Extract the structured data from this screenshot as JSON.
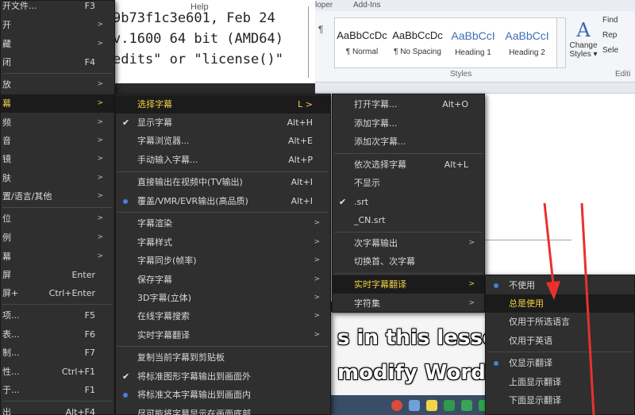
{
  "console": {
    "lines": [
      "9b73f1c3e601, Feb 24",
      "v.1600 64 bit (AMD64)",
      "",
      "edits\" or \"license()\""
    ],
    "tab_label": "Help"
  },
  "word": {
    "tabs": [
      "loper",
      "Add-Ins"
    ],
    "paragraph_mark": "¶",
    "styles": [
      {
        "preview": "AaBbCcDc",
        "name": "¶ Normal"
      },
      {
        "preview": "AaBbCcDc",
        "name": "¶ No Spacing"
      },
      {
        "preview": "AaBbCcI",
        "name": "Heading 1"
      },
      {
        "preview": "AaBbCcI",
        "name": "Heading 2"
      }
    ],
    "change_styles": {
      "glyph": "A",
      "label_line1": "Change",
      "label_line2": "Styles ▾"
    },
    "editing": [
      "Find",
      "Rep",
      "Sele"
    ],
    "captions": {
      "styles": "Styles",
      "editing": "Editi"
    }
  },
  "video": {
    "subtitle_line1": "s in this lesson",
    "subtitle_line2": "modify Word"
  },
  "menu_main": {
    "items": [
      {
        "label": "开文件...",
        "shortcut": "F3",
        "arrow": false
      },
      {
        "label": "开",
        "shortcut": "",
        "arrow": true
      },
      {
        "label": "藏",
        "shortcut": "",
        "arrow": true
      },
      {
        "label": "闭",
        "shortcut": "F4",
        "arrow": false
      },
      {
        "label": "放",
        "shortcut": "",
        "arrow": true
      },
      {
        "label": "幕",
        "shortcut": "",
        "arrow": true,
        "highlight": true
      },
      {
        "label": "频",
        "shortcut": "",
        "arrow": true
      },
      {
        "label": "音",
        "shortcut": "",
        "arrow": true
      },
      {
        "label": "镜",
        "shortcut": "",
        "arrow": true
      },
      {
        "label": "肤",
        "shortcut": "",
        "arrow": true
      },
      {
        "label": "置/语言/其他",
        "shortcut": "",
        "arrow": true
      },
      {
        "label": "位",
        "shortcut": "",
        "arrow": true
      },
      {
        "label": "例",
        "shortcut": "",
        "arrow": true
      },
      {
        "label": "幕",
        "shortcut": "",
        "arrow": true
      },
      {
        "label": "屏",
        "shortcut": "Enter",
        "arrow": false
      },
      {
        "label": "屏+",
        "shortcut": "Ctrl+Enter",
        "arrow": false
      },
      {
        "label": "项...",
        "shortcut": "F5",
        "arrow": false
      },
      {
        "label": "表...",
        "shortcut": "F6",
        "arrow": false
      },
      {
        "label": "制...",
        "shortcut": "F7",
        "arrow": false
      },
      {
        "label": "性...",
        "shortcut": "Ctrl+F1",
        "arrow": false
      },
      {
        "label": "于...",
        "shortcut": "F1",
        "arrow": false
      },
      {
        "label": "出",
        "shortcut": "Alt+F4",
        "arrow": false
      }
    ]
  },
  "menu_sub": {
    "items": [
      {
        "label": "选择字幕",
        "shortcut": "L >",
        "highlight": true
      },
      {
        "label": "显示字幕",
        "shortcut": "Alt+H",
        "mark": "check"
      },
      {
        "label": "字幕浏览器...",
        "shortcut": "Alt+E"
      },
      {
        "label": "手动输入字幕...",
        "shortcut": "Alt+P"
      },
      {
        "label": "直接输出在视频中(TV输出)",
        "shortcut": "Alt+I"
      },
      {
        "label": "覆盖/VMR/EVR输出(高品质)",
        "shortcut": "Alt+I",
        "mark": "dot"
      },
      {
        "label": "字幕渲染",
        "arrow": true
      },
      {
        "label": "字幕样式",
        "arrow": true
      },
      {
        "label": "字幕同步(帧率)",
        "arrow": true
      },
      {
        "label": "保存字幕",
        "arrow": true
      },
      {
        "label": "3D字幕(立体)",
        "arrow": true
      },
      {
        "label": "在线字幕搜索",
        "arrow": true
      },
      {
        "label": "实时字幕翻译",
        "arrow": true
      },
      {
        "label": "复制当前字幕到剪贴板"
      },
      {
        "label": "将标准图形字幕输出到画面外",
        "mark": "check"
      },
      {
        "label": "将标准文本字幕输出到画面内",
        "mark": "dot"
      },
      {
        "label": "尽可能将字幕显示在画面底部"
      }
    ]
  },
  "menu_sub2": {
    "items": [
      {
        "label": "打开字幕...",
        "shortcut": "Alt+O"
      },
      {
        "label": "添加字幕..."
      },
      {
        "label": "添加次字幕..."
      },
      {
        "label": "依次选择字幕",
        "shortcut": "Alt+L"
      },
      {
        "label": "不显示"
      },
      {
        "label": ".srt",
        "mark": "check"
      },
      {
        "label": "_CN.srt"
      },
      {
        "label": "次字幕输出",
        "arrow": true
      },
      {
        "label": "切换首、次字幕"
      },
      {
        "label": "实时字幕翻译",
        "arrow": true,
        "highlight": true
      },
      {
        "label": "字符集",
        "arrow": true
      }
    ]
  },
  "menu_sub3": {
    "items": [
      {
        "label": "不使用",
        "mark": "dot"
      },
      {
        "label": "总是使用",
        "highlight": true
      },
      {
        "label": "仅用于所选语言"
      },
      {
        "label": "仅用于英语"
      },
      {
        "label": "仅显示翻译",
        "mark": "dot"
      },
      {
        "label": "上面显示翻译"
      },
      {
        "label": "下面显示翻译"
      }
    ]
  },
  "colors": {
    "menu_bg": "#2f2f2f",
    "highlight_text": "#f2d043",
    "radio_dot": "#4a7fd8",
    "annotation_arrow": "#e8312f"
  }
}
